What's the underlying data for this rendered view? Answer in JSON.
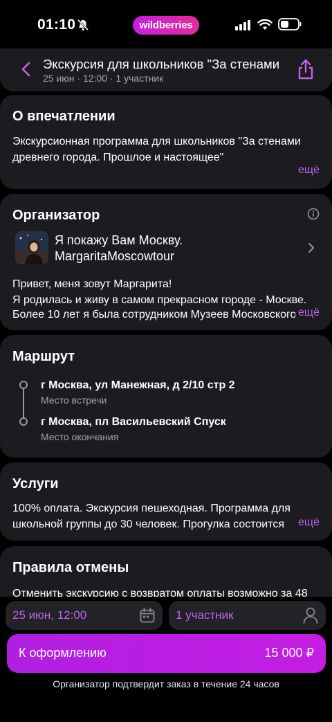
{
  "status_bar": {
    "time": "01:10",
    "brand": "wildberries"
  },
  "header": {
    "title": "Экскурсия для школьников \"За стенами",
    "subtitle": "25 июн · 12:00 · 1 участник"
  },
  "about": {
    "title": "О впечатлении",
    "text": "Экскурсионная программа для  школьников \"За стенами древнего города. Прошлое и настоящее\"",
    "more": "ещё"
  },
  "organizer": {
    "title": "Организатор",
    "name_line1": "Я покажу Вам Москву.",
    "name_line2": "MargaritaMoscowtour",
    "bio_line1": "Привет, меня зовут Маргарита!",
    "bio_line2": "Я родилась и живу в самом прекрасном городе - Москве.",
    "bio_line3": "Более 10 лет я была сотрудником Музеев Московского",
    "more": "ещё"
  },
  "route": {
    "title": "Маршрут",
    "stops": [
      {
        "address": "г Москва, ул Манежная, д 2/10 стр 2",
        "label": "Место встречи"
      },
      {
        "address": "г Москва, пл Васильевский Спуск",
        "label": "Место окончания"
      }
    ]
  },
  "services": {
    "title": "Услуги",
    "line1": "100% оплата. Экскурсия пешеходная. Программа для",
    "line2": "школьной группы до 30 человек. Прогулка состоится",
    "more": "ещё"
  },
  "cancel": {
    "title": "Правила отмены",
    "text": "Отменить экскурсию с возвратом оплаты возможно за 48"
  },
  "booking": {
    "date_value": "25 июн, 12:00",
    "participants_value": "1 участник",
    "cta_label": "К оформлению",
    "cta_price": "15 000 ₽",
    "note": "Организатор подтвердит заказ в течение 24 часов"
  },
  "colors": {
    "accent": "#c062f0",
    "card": "#1c1b1f",
    "cta": "#b01fe0"
  }
}
